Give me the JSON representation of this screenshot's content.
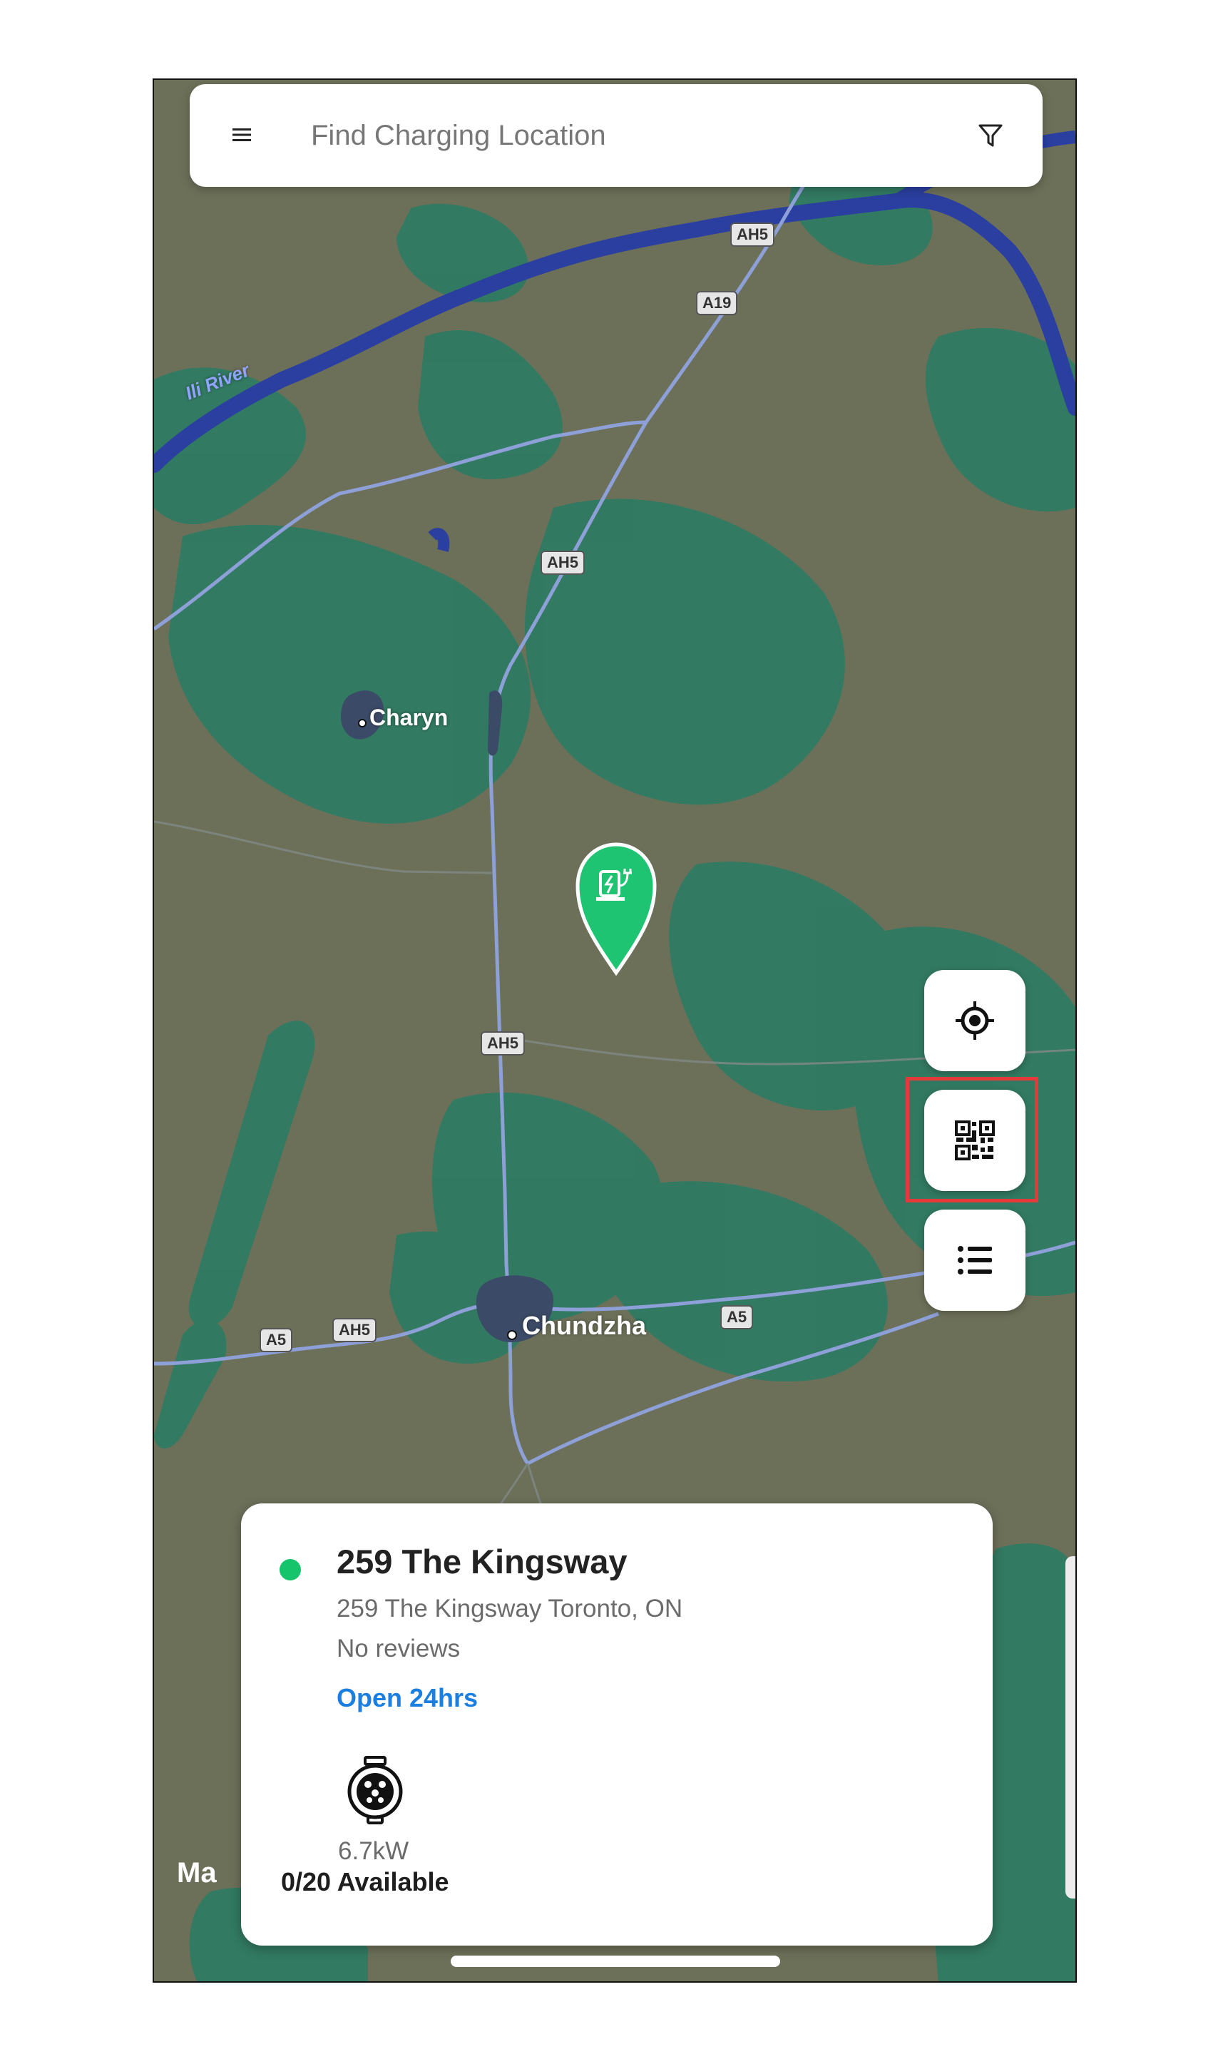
{
  "search": {
    "placeholder": "Find Charging Location"
  },
  "icons": {
    "menu": "hamburger-menu-icon",
    "filter": "funnel-filter-icon",
    "locate": "crosshair-location-icon",
    "qr": "qr-code-icon",
    "list": "list-icon",
    "marker": "ev-charger-pin-icon",
    "connector": "j1772-connector-icon"
  },
  "map": {
    "river_label": "Ili River",
    "places": [
      "Charyn",
      "Chundzha"
    ],
    "road_shields": [
      "AH5",
      "A19",
      "AH5",
      "AH5",
      "A5",
      "AH5",
      "A5"
    ],
    "attribution": "Ma",
    "colors": {
      "land": "#6d7059",
      "forest": "#2f7a63",
      "water": "#2a3fa0",
      "road": "#8ea0d8",
      "marker": "#1fc472"
    }
  },
  "card": {
    "title": "259 The Kingsway",
    "address": "259 The Kingsway Toronto, ON",
    "reviews": "No reviews",
    "hours": "Open 24hrs",
    "power": "6.7kW",
    "availability": "0/20 Available",
    "status_color": "#16c46b",
    "hours_color": "#1a7fe0"
  },
  "highlight": {
    "target": "qr-code-button",
    "color": "#e5393a"
  }
}
